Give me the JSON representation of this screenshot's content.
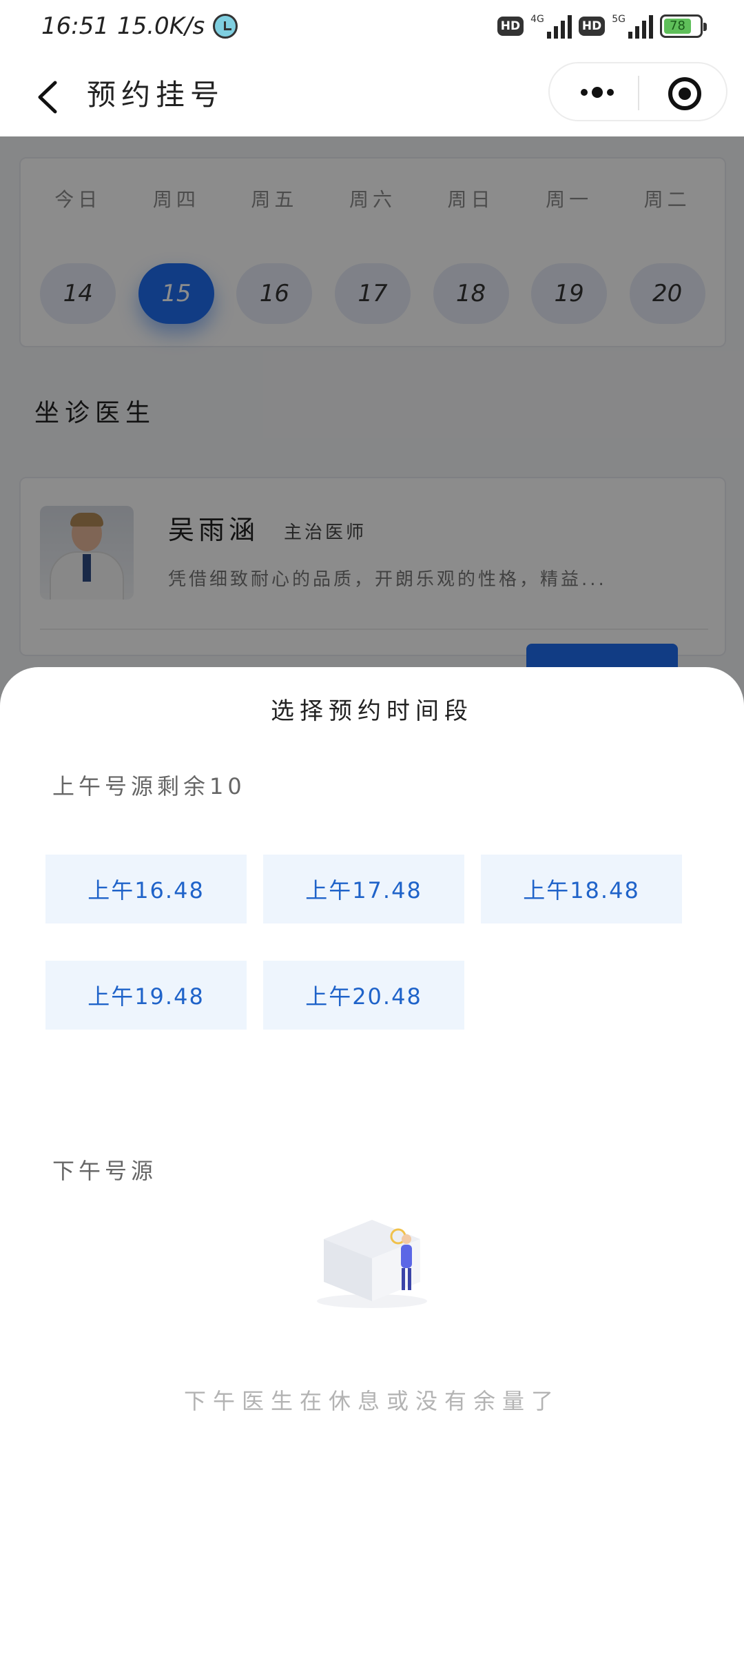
{
  "status_bar": {
    "time": "16:51",
    "speed": "15.0K/s",
    "net1": "4G",
    "net2": "5G",
    "hd1": "HD",
    "hd2": "HD",
    "battery": "78"
  },
  "nav": {
    "title": "预约挂号"
  },
  "calendar": {
    "weekdays": [
      "今日",
      "周四",
      "周五",
      "周六",
      "周日",
      "周一",
      "周二"
    ],
    "dates": [
      "14",
      "15",
      "16",
      "17",
      "18",
      "19",
      "20"
    ],
    "selected_date": "15"
  },
  "doctors_section": {
    "title": "坐诊医生"
  },
  "doctor": {
    "name": "吴雨涵",
    "rank": "主治医师",
    "description": "凭借细致耐心的品质，开朗乐观的性格，精益..."
  },
  "sheet": {
    "title": "选择预约时间段",
    "am_header": "上午号源剩余10",
    "am_slots": [
      "上午16.48",
      "上午17.48",
      "上午18.48",
      "上午19.48",
      "上午20.48"
    ],
    "pm_header": "下午号源",
    "pm_empty_text": "下午医生在休息或没有余量了"
  },
  "colors": {
    "accent": "#1f6ef0",
    "slot_bg": "#eef5fd",
    "slot_text": "#1f63c9"
  }
}
